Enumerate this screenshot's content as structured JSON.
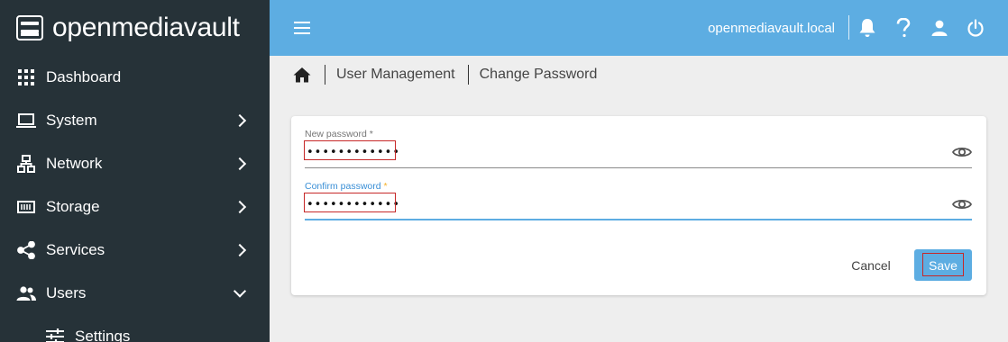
{
  "brand": {
    "name": "openmediavault"
  },
  "sidebar": {
    "items": [
      {
        "label": "Dashboard",
        "icon": "grid-icon"
      },
      {
        "label": "System",
        "icon": "laptop-icon"
      },
      {
        "label": "Network",
        "icon": "network-icon"
      },
      {
        "label": "Storage",
        "icon": "storage-icon"
      },
      {
        "label": "Services",
        "icon": "share-icon"
      },
      {
        "label": "Users",
        "icon": "users-icon"
      },
      {
        "label": "Settings",
        "icon": "tune-icon"
      }
    ]
  },
  "topbar": {
    "hostname": "openmediavault.local",
    "icons": [
      "menu-icon",
      "bell-icon",
      "help-icon",
      "user-icon",
      "power-icon"
    ]
  },
  "breadcrumb": {
    "items": [
      "User Management",
      "Change Password"
    ]
  },
  "form": {
    "new_password": {
      "label": "New password",
      "required": "*",
      "value": "••••••••••••"
    },
    "confirm_password": {
      "label": "Confirm password",
      "required": "*",
      "value": "••••••••••••"
    },
    "cancel_label": "Cancel",
    "save_label": "Save"
  },
  "colors": {
    "sidebar_bg": "#263238",
    "topbar_bg": "#5dade2",
    "accent": "#5dade2",
    "page_bg": "#eeeeee"
  }
}
